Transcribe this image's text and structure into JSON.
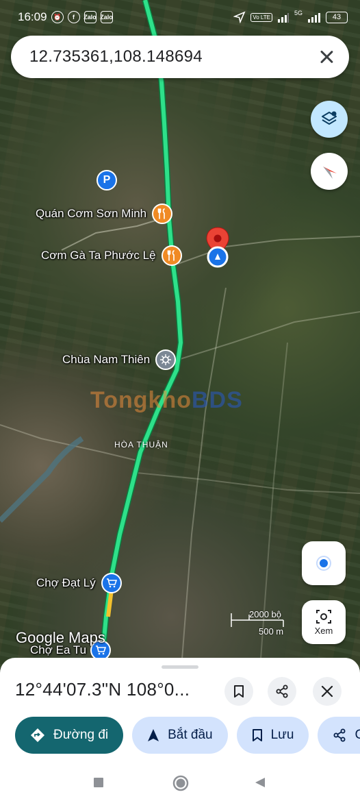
{
  "status_bar": {
    "time": "16:09",
    "icons": [
      "alarm-icon",
      "facebook-icon",
      "zalo-icon",
      "zalo-icon"
    ],
    "zalo_label": "Zalo",
    "network": "5G",
    "volte": "Vo LTE",
    "battery": "43"
  },
  "search": {
    "query": "12.735361,108.148694"
  },
  "map": {
    "pois": [
      {
        "label": "Quán Cơm Sơn Minh",
        "icon": "restaurant-icon"
      },
      {
        "label": "Cơm Gà Ta Phước Lệ",
        "icon": "restaurant-icon"
      },
      {
        "label": "Chùa Nam Thiên",
        "icon": "temple-icon"
      },
      {
        "label": "Chợ Đạt Lý",
        "icon": "shopping-icon"
      },
      {
        "label": "Chợ Ea Tu",
        "icon": "shopping-icon"
      }
    ],
    "area_label": "HÒA THUẬN",
    "watermark": {
      "part1": "Tongkho",
      "part2": "BDS"
    },
    "scale": {
      "imperial": "2000 bộ",
      "metric": "500 m"
    },
    "logo": "Google Maps",
    "xem_label": "Xem"
  },
  "sheet": {
    "coords": "12°44'07.3\"N 108°0...",
    "actions": {
      "directions": "Đường đi",
      "start": "Bắt đầu",
      "save": "Lưu",
      "share": "Ch"
    }
  },
  "colors": {
    "route": "#28d07a",
    "primary_chip": "#14666f",
    "chip": "#d3e3fd",
    "pin_red": "#ea4335",
    "food": "#f08a24",
    "blue": "#1a73e8"
  }
}
